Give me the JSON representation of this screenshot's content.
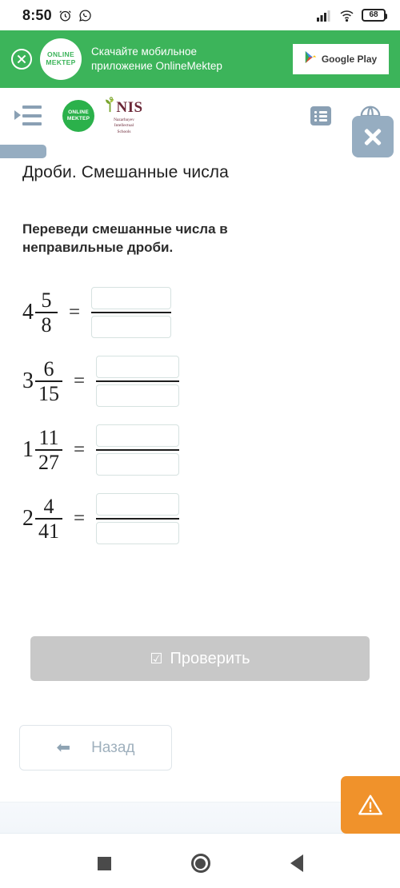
{
  "status_bar": {
    "time": "8:50",
    "alarm_icon": "alarm-clock-icon",
    "whatsapp_icon": "whatsapp-icon",
    "signal_icon": "cellular-signal-icon",
    "wifi_icon": "wifi-icon",
    "battery_level": "68"
  },
  "promo_banner": {
    "close_icon": "close-circle-icon",
    "logo_line1": "ONLINE",
    "logo_line2": "MEKTEP",
    "text_line1": "Скачайте мобильное",
    "text_line2": "приложение OnlineMektep",
    "store_button_label": "Google Play",
    "background_color": "#3cb45a"
  },
  "app_header": {
    "menu_icon": "hamburger-menu-icon",
    "brand_logo_line1": "ONLINE",
    "brand_logo_line2": "MEKTEP",
    "nis_logo_word": "NIS",
    "nis_logo_sub_line1": "Nazarbayev",
    "nis_logo_sub_line2": "Intellectual",
    "nis_logo_sub_line3": "Schools",
    "list_icon": "list-view-icon",
    "globe_icon": "globe-language-icon",
    "close_overlay_icon": "close-x-icon"
  },
  "main": {
    "page_title": "Дроби. Смешанные числа",
    "question": "Переведи смешанные числа в неправильные дроби.",
    "equals_sign": "=",
    "answer_placeholder": "",
    "problems": [
      {
        "whole": "4",
        "numerator": "5",
        "denominator": "8",
        "answer_numerator": "",
        "answer_denominator": ""
      },
      {
        "whole": "3",
        "numerator": "6",
        "denominator": "15",
        "answer_numerator": "",
        "answer_denominator": ""
      },
      {
        "whole": "1",
        "numerator": "11",
        "denominator": "27",
        "answer_numerator": "",
        "answer_denominator": ""
      },
      {
        "whole": "2",
        "numerator": "4",
        "denominator": "41",
        "answer_numerator": "",
        "answer_denominator": ""
      }
    ]
  },
  "actions": {
    "check_label": "Проверить",
    "check_icon": "checkbox-checked-icon",
    "check_color": "#c8c8c8",
    "back_label": "Назад",
    "back_icon": "arrow-left-icon",
    "warning_icon": "warning-triangle-icon",
    "warning_color": "#f0922b"
  },
  "nav_bar": {
    "recents_icon": "square-recents-icon",
    "home_icon": "circle-home-icon",
    "back_icon": "triangle-back-icon"
  }
}
